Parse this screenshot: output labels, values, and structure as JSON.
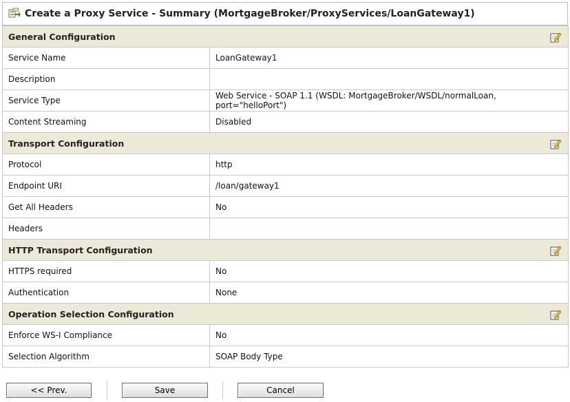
{
  "title": "Create a Proxy Service - Summary (MortgageBroker/ProxyServices/LoanGateway1)",
  "sections": [
    {
      "heading": "General Configuration",
      "rows": [
        {
          "label": "Service Name",
          "value": "LoanGateway1"
        },
        {
          "label": "Description",
          "value": ""
        },
        {
          "label": "Service Type",
          "value": "Web Service - SOAP 1.1 (WSDL: MortgageBroker/WSDL/normalLoan, port=\"helloPort\")"
        },
        {
          "label": "Content Streaming",
          "value": "Disabled"
        }
      ]
    },
    {
      "heading": "Transport Configuration",
      "rows": [
        {
          "label": "Protocol",
          "value": "http"
        },
        {
          "label": "Endpoint URI",
          "value": "/loan/gateway1"
        },
        {
          "label": "Get All Headers",
          "value": "No"
        },
        {
          "label": "Headers",
          "value": ""
        }
      ]
    },
    {
      "heading": "HTTP Transport Configuration",
      "rows": [
        {
          "label": "HTTPS required",
          "value": "No"
        },
        {
          "label": "Authentication",
          "value": "None"
        }
      ]
    },
    {
      "heading": "Operation Selection Configuration",
      "rows": [
        {
          "label": "Enforce WS-I Compliance",
          "value": "No"
        },
        {
          "label": "Selection Algorithm",
          "value": "SOAP Body Type"
        }
      ]
    }
  ],
  "buttons": {
    "prev": "<< Prev.",
    "save": "Save",
    "cancel": "Cancel"
  },
  "icons": {
    "title": "proxy-service-icon",
    "edit": "edit-pencil-icon"
  }
}
